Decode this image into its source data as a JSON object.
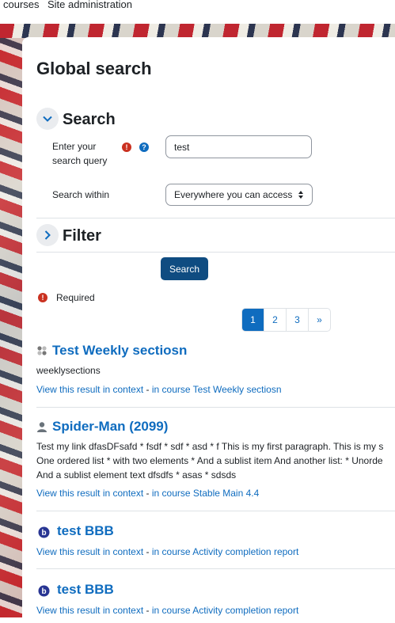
{
  "topnav": {
    "courses": "courses",
    "site_admin": "Site administration"
  },
  "page_title": "Global search",
  "search_section": {
    "title": "Search",
    "query_label_line1": "Enter your",
    "query_label_line2": "search query",
    "query_value": "test",
    "within_label": "Search within",
    "within_value": "Everywhere you can access"
  },
  "filter_section": {
    "title": "Filter"
  },
  "search_button": "Search",
  "required_note": "Required",
  "pagination": {
    "pages": [
      "1",
      "2",
      "3"
    ],
    "next": "»",
    "current": "1"
  },
  "results": [
    {
      "title": "Test Weekly sectiosn",
      "icon": "course-icon",
      "description_lines": [
        "weeklysections"
      ],
      "context_link": "View this result in context",
      "separator": "-",
      "course_link": "in course Test Weekly sectiosn"
    },
    {
      "title": "Spider-Man (2099)",
      "icon": "user-icon",
      "description_lines": [
        "Test my link dfasDFsafd * fsdf * sdf * asd * f This is my first paragraph. This is my s",
        "One ordered list * with two elements * And a sublist item And another list: * Unorde",
        "And a sublist element text dfsdfs * asas * sdsds"
      ],
      "context_link": "View this result in context",
      "separator": "-",
      "course_link": "in course Stable Main 4.4"
    },
    {
      "title": "test BBB",
      "icon": "bigbluebutton-icon",
      "description_lines": [],
      "context_link": "View this result in context",
      "separator": "-",
      "course_link": "in course Activity completion report"
    },
    {
      "title": "test BBB",
      "icon": "bigbluebutton-icon",
      "description_lines": [],
      "context_link": "View this result in context",
      "separator": "-",
      "course_link": "in course Activity completion report"
    }
  ],
  "colors": {
    "link": "#0f6cbf",
    "primary_button": "#0f4c81",
    "required": "#ca3120"
  }
}
